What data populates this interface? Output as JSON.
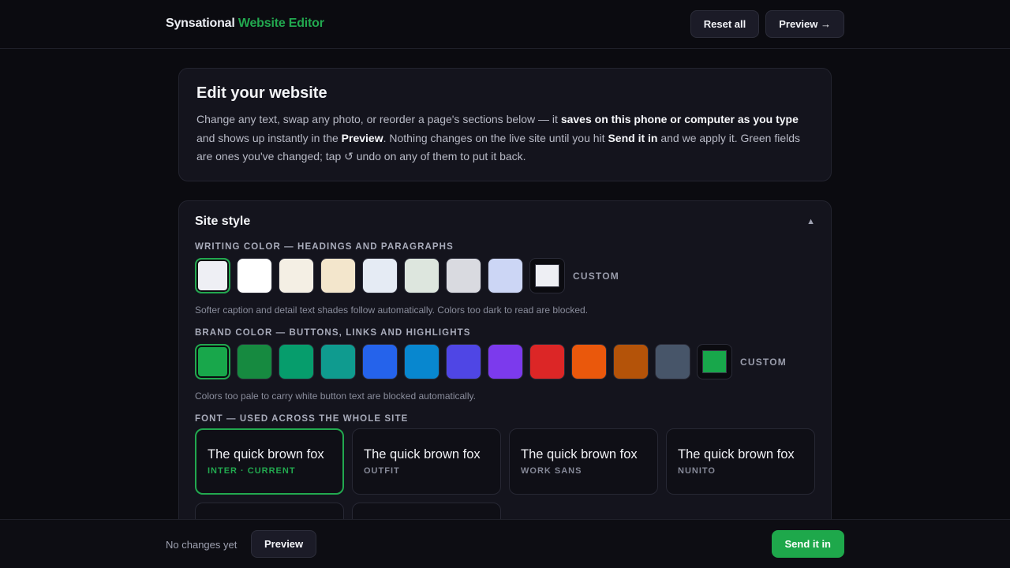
{
  "header": {
    "brand_name": "Synsational",
    "brand_accent": "Website Editor",
    "reset_label": "Reset all",
    "preview_label": "Preview →"
  },
  "intro": {
    "title": "Edit your website",
    "p1": "Change any text, swap any photo, or reorder a page's sections below — it ",
    "b1": "saves on this phone or computer as you type",
    "p2": " and shows up instantly in the ",
    "b2": "Preview",
    "p3": ". Nothing changes on the live site until you hit ",
    "b3": "Send it in",
    "p4": " and we apply it. Green fields are ones you've changed; tap ↺ undo on any of them to put it back."
  },
  "site_style": {
    "title": "Site style",
    "collapse_icon": "▲",
    "writing_color": {
      "label": "Writing color — headings and paragraphs",
      "swatches": [
        "#eeeff4",
        "#ffffff",
        "#f4efe4",
        "#f3e6cc",
        "#e5ebf4",
        "#dde6de",
        "#d9dae0",
        "#ccd6f5"
      ],
      "selected_index": 0,
      "custom_color": "#eeeff4",
      "custom_label": "CUSTOM",
      "hint": "Softer caption and detail text shades follow automatically. Colors too dark to read are blocked."
    },
    "brand_color": {
      "label": "Brand color — buttons, links and highlights",
      "swatches": [
        "#18a74b",
        "#168a40",
        "#069d6c",
        "#0f9b8f",
        "#2563eb",
        "#0887cf",
        "#4f46e5",
        "#7c3aed",
        "#dc2626",
        "#ea580c",
        "#b45309",
        "#475569"
      ],
      "selected_index": 0,
      "custom_color": "#18a74b",
      "custom_label": "CUSTOM",
      "hint": "Colors too pale to carry white button text are blocked automatically."
    },
    "font": {
      "label": "Font — used across the whole site",
      "options": [
        {
          "sample": "The quick brown fox",
          "name": "INTER · CURRENT",
          "selected": true
        },
        {
          "sample": "The quick brown fox",
          "name": "OUTFIT",
          "selected": false
        },
        {
          "sample": "The quick brown fox",
          "name": "WORK SANS",
          "selected": false
        },
        {
          "sample": "The quick brown fox",
          "name": "NUNITO",
          "selected": false
        }
      ]
    }
  },
  "footer": {
    "status": "No changes yet",
    "preview_label": "Preview",
    "send_label": "Send it in"
  }
}
